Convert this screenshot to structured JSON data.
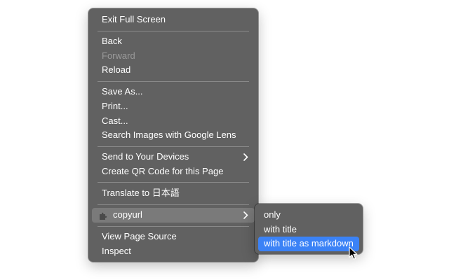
{
  "main_menu": {
    "items": [
      {
        "label": "Exit Full Screen"
      },
      {
        "label": "Back"
      },
      {
        "label": "Forward",
        "disabled": true
      },
      {
        "label": "Reload"
      },
      {
        "label": "Save As..."
      },
      {
        "label": "Print..."
      },
      {
        "label": "Cast..."
      },
      {
        "label": "Search Images with Google Lens"
      },
      {
        "label": "Send to Your Devices",
        "submenu": true
      },
      {
        "label": "Create QR Code for this Page"
      },
      {
        "label": "Translate to 日本語"
      },
      {
        "label": "copyurl",
        "icon": "puzzle-extension-icon",
        "submenu": true,
        "highlighted": true
      },
      {
        "label": "View Page Source"
      },
      {
        "label": "Inspect"
      }
    ]
  },
  "sub_menu": {
    "items": [
      {
        "label": "only"
      },
      {
        "label": "with title"
      },
      {
        "label": "with title as markdown",
        "highlighted": true
      }
    ]
  },
  "colors": {
    "menu_bg": "#616161",
    "highlight_gray": "#7a7a7a",
    "highlight_blue": "#3b82f6",
    "disabled_text": "#9a9a9a"
  }
}
